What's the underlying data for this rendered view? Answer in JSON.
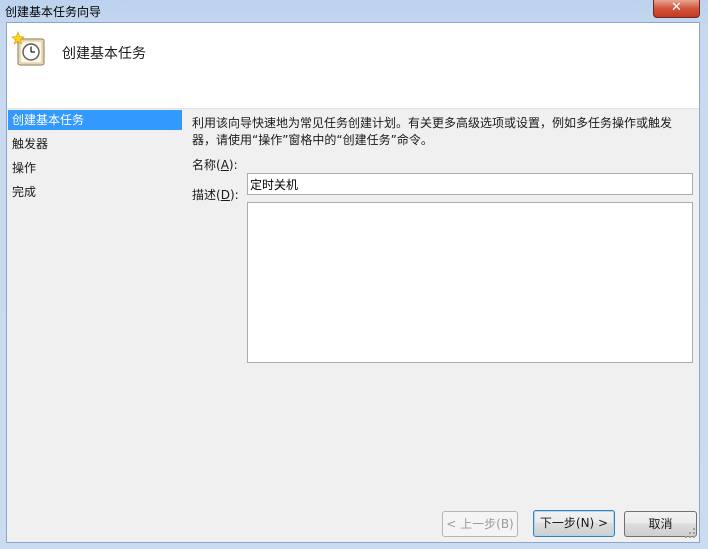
{
  "window": {
    "title": "创建基本任务向导",
    "close_glyph": "✕"
  },
  "header": {
    "title": "创建基本任务",
    "icon": "task-scheduler-clock-icon"
  },
  "nav": {
    "items": [
      {
        "label": "创建基本任务",
        "selected": true
      },
      {
        "label": "触发器",
        "selected": false
      },
      {
        "label": "操作",
        "selected": false
      },
      {
        "label": "完成",
        "selected": false
      }
    ]
  },
  "content": {
    "description_line1": "利用该向导快速地为常见任务创建计划。有关更多高级选项或设置，例如多任务操作或触发",
    "description_line2": "器，请使用“操作”窗格中的“创建任务”命令。",
    "name_label": "名称(",
    "name_accel": "A",
    "name_label_end": "):",
    "name_value": "定时关机",
    "desc_label": "描述(",
    "desc_accel": "D",
    "desc_label_end": "):",
    "desc_value": ""
  },
  "buttons": {
    "back": "< 上一步(B)",
    "next": "下一步(N) >",
    "cancel": "取消"
  },
  "colors": {
    "selection": "#3399ff",
    "client_bg": "#f0f0f0"
  }
}
